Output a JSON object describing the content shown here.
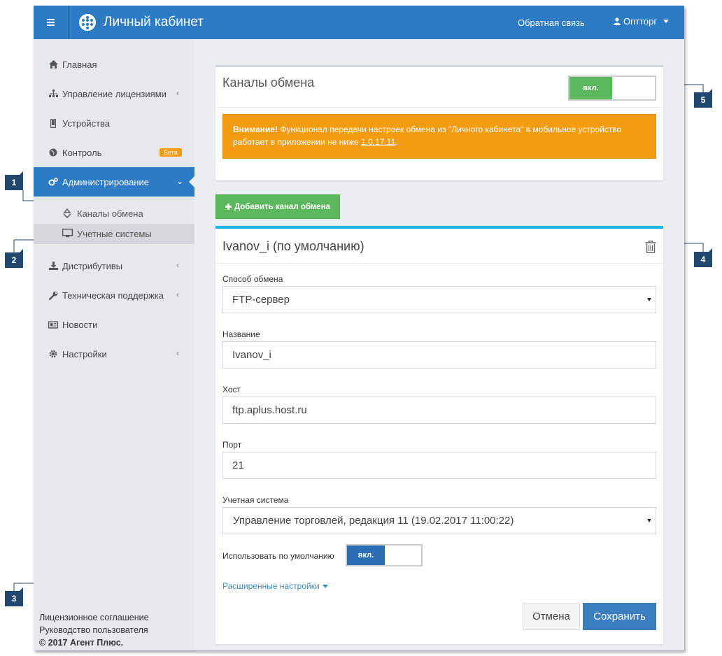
{
  "header": {
    "app_title": "Личный кабинет",
    "feedback_link": "Обратная связь",
    "user_name": "Оптторг"
  },
  "sidebar": {
    "items": [
      {
        "label": "Главная",
        "icon": "home-icon"
      },
      {
        "label": "Управление лицензиями",
        "icon": "sitemap-icon",
        "chevron": "‹"
      },
      {
        "label": "Устройства",
        "icon": "mobile-icon"
      },
      {
        "label": "Контроль",
        "icon": "globe-icon",
        "badge": "Бета"
      },
      {
        "label": "Администрирование",
        "icon": "cogs-icon",
        "chevron": "⌄"
      },
      {
        "label": "Дистрибутивы",
        "icon": "download-icon",
        "chevron": "‹"
      },
      {
        "label": "Техническая поддержка",
        "icon": "wrench-icon",
        "chevron": "‹"
      },
      {
        "label": "Новости",
        "icon": "newspaper-icon"
      },
      {
        "label": "Настройки",
        "icon": "gear-icon",
        "chevron": "‹"
      }
    ],
    "subitems": [
      {
        "label": "Каналы обмена",
        "icon": "recycle-icon"
      },
      {
        "label": "Учетные системы",
        "icon": "desktop-icon"
      }
    ],
    "footer": {
      "license": "Лицензионное соглашение",
      "manual": "Руководство пользователя",
      "copyright": "© 2017 Агент Плюс."
    }
  },
  "channels_panel": {
    "title": "Каналы обмена",
    "toggle_label": "вкл.",
    "alert": {
      "bold": "Внимание!",
      "text": " Функционал передачи настроек обмена из \"Личного кабинета\" в мобильное устройство работает в приложении не ниже ",
      "version": "1.0.17.11",
      "end": "."
    }
  },
  "add_button": "Добавить канал обмена",
  "channel_card": {
    "title": "Ivanov_i (по умолчанию)",
    "exchange_method_label": "Способ обмена",
    "exchange_method_value": "FTP-сервер",
    "name_label": "Название",
    "name_value": "Ivanov_i",
    "host_label": "Хост",
    "host_value": "ftp.aplus.host.ru",
    "port_label": "Порт",
    "port_value": "21",
    "account_system_label": "Учетная система",
    "account_system_value": "Управление торговлей, редакция 11 (19.02.2017 11:00:22)",
    "default_label": "Использовать по умолчанию",
    "default_toggle": "вкл.",
    "advanced_link": "Расширенные настройки",
    "cancel": "Отмена",
    "save": "Сохранить"
  },
  "callouts": [
    "1",
    "2",
    "3",
    "4",
    "5"
  ],
  "colors": {
    "brand": "#2c7bc4",
    "success": "#5cb85c",
    "warning": "#f39c12",
    "card_accent": "#1ab7ea",
    "callout": "#23486f"
  }
}
